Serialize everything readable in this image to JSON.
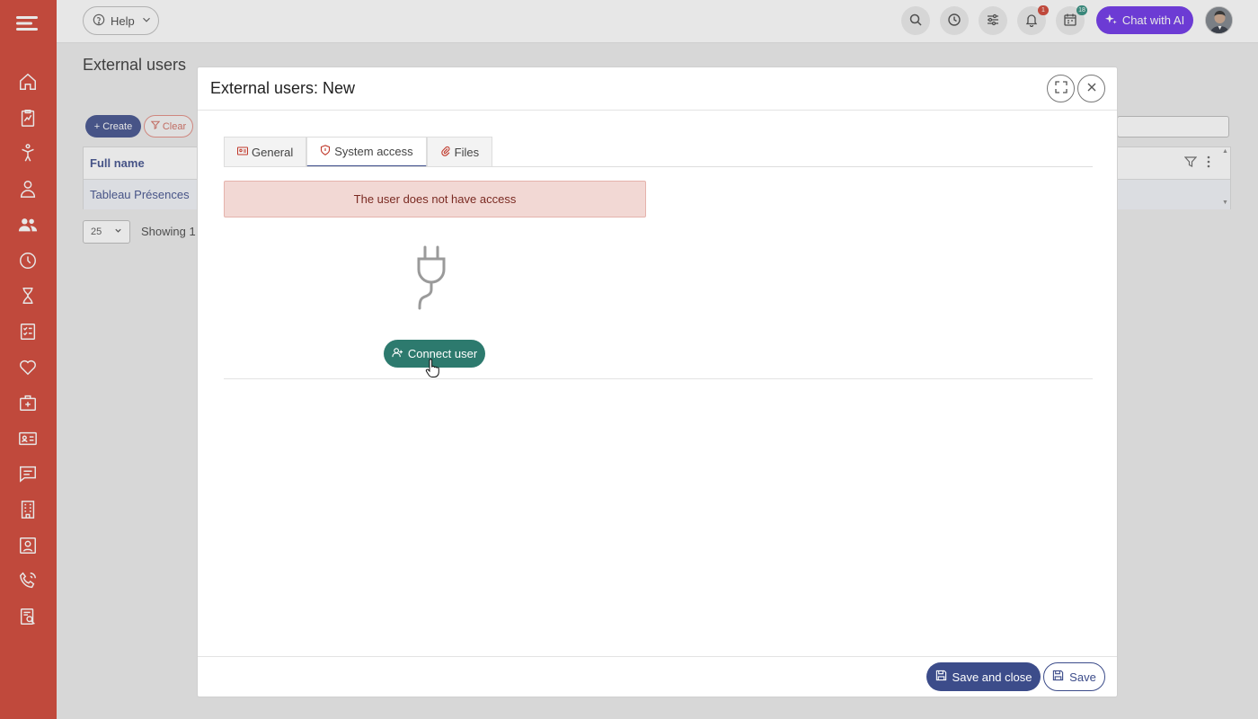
{
  "topbar": {
    "help_label": "Help",
    "chat_label": "Chat with AI",
    "notifications_count": "1",
    "calendar_count": "18"
  },
  "page": {
    "title": "External users",
    "create_label": "Create",
    "clear_label": "Clear",
    "table": {
      "columns": [
        "Full name"
      ],
      "rows": [
        [
          "Tableau Présences"
        ]
      ]
    },
    "page_size": "25",
    "showing_text": "Showing 1"
  },
  "modal": {
    "title": "External users: New",
    "tabs": [
      {
        "label": "General",
        "icon": "id-card-icon"
      },
      {
        "label": "System access",
        "icon": "shield-icon"
      },
      {
        "label": "Files",
        "icon": "paperclip-icon"
      }
    ],
    "active_tab": "System access",
    "alert_text": "The user does not have access",
    "connect_label": "Connect user",
    "save_close_label": "Save and close",
    "save_label": "Save"
  },
  "colors": {
    "sidebar": "#d03f2f",
    "primary": "#3c4c8a",
    "connect": "#2d7a6e",
    "chat": "#6a2ee8",
    "alert_bg": "#f2d8d4"
  }
}
